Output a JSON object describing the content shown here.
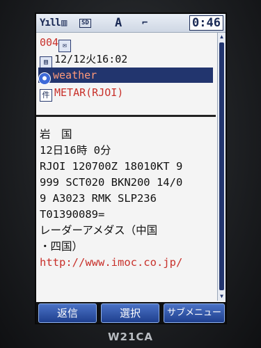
{
  "status_bar": {
    "signal": "Yıll",
    "battery": "▥",
    "sd": "SD",
    "mode": "A",
    "key": "⌐",
    "clock": "0:46"
  },
  "message": {
    "number": "004",
    "datetime": "12/12火16:02",
    "sender": "weather",
    "subject": "METAR(RJOI)"
  },
  "body_lines": [
    "岩　国",
    "12日16時 0分",
    "RJOI 120700Z 18010KT 9",
    "999 SCT020 BKN200 14/0",
    "9 A3023 RMK SLP236",
    "T01390089=",
    "レーダーアメダス（中国",
    "・四国）",
    "http://www.imoc.co.jp/"
  ],
  "softkeys": {
    "left": "返信",
    "center": "選択",
    "right": "サブメニュー"
  },
  "device_model": "W21CA"
}
